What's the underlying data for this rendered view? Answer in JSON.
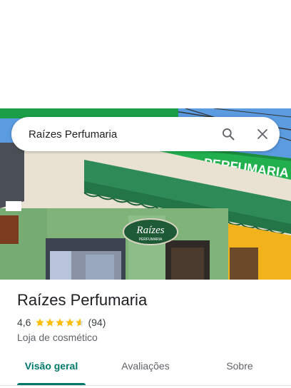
{
  "search": {
    "query": "Raízes Perfumaria",
    "search_icon": "search-icon",
    "close_icon": "close-icon"
  },
  "photo": {
    "store_sign_text": "PERFUMARIA",
    "oval_sign_text": "Raízes",
    "oval_sign_subtext": "PERFUMARIA"
  },
  "place": {
    "name": "Raízes Perfumaria",
    "rating": "4,6",
    "rating_value": 4.6,
    "reviews": "(94)",
    "category": "Loja de cosmético",
    "star_color": "#fbbc04"
  },
  "tabs": [
    {
      "label": "Visão geral",
      "active": true
    },
    {
      "label": "Avaliações",
      "active": false
    },
    {
      "label": "Sobre",
      "active": false
    }
  ],
  "colors": {
    "accent": "#00796b"
  }
}
